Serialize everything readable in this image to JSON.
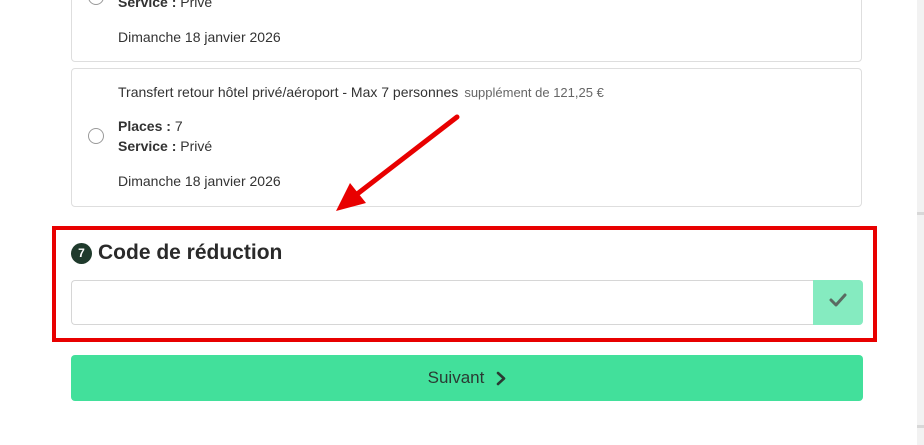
{
  "options": [
    {
      "title": "",
      "supplement": "",
      "service_label": "Service :",
      "service_value": "Privé",
      "date": "Dimanche 18 janvier 2026"
    },
    {
      "title": "Transfert retour hôtel privé/aéroport - Max 7 personnes",
      "supplement": "supplément de 121,25 €",
      "places_label": "Places :",
      "places_value": "7",
      "service_label": "Service :",
      "service_value": "Privé",
      "date": "Dimanche 18 janvier 2026"
    }
  ],
  "discount": {
    "step_number": "7",
    "title": "Code de réduction",
    "input_value": "",
    "apply_icon": "check-icon"
  },
  "next_button": {
    "label": "Suivant",
    "icon": "chevron-right-icon"
  },
  "colors": {
    "highlight": "#e80000",
    "primary": "#42e09b",
    "apply": "#85ebc0",
    "badge": "#1f3a2c"
  }
}
